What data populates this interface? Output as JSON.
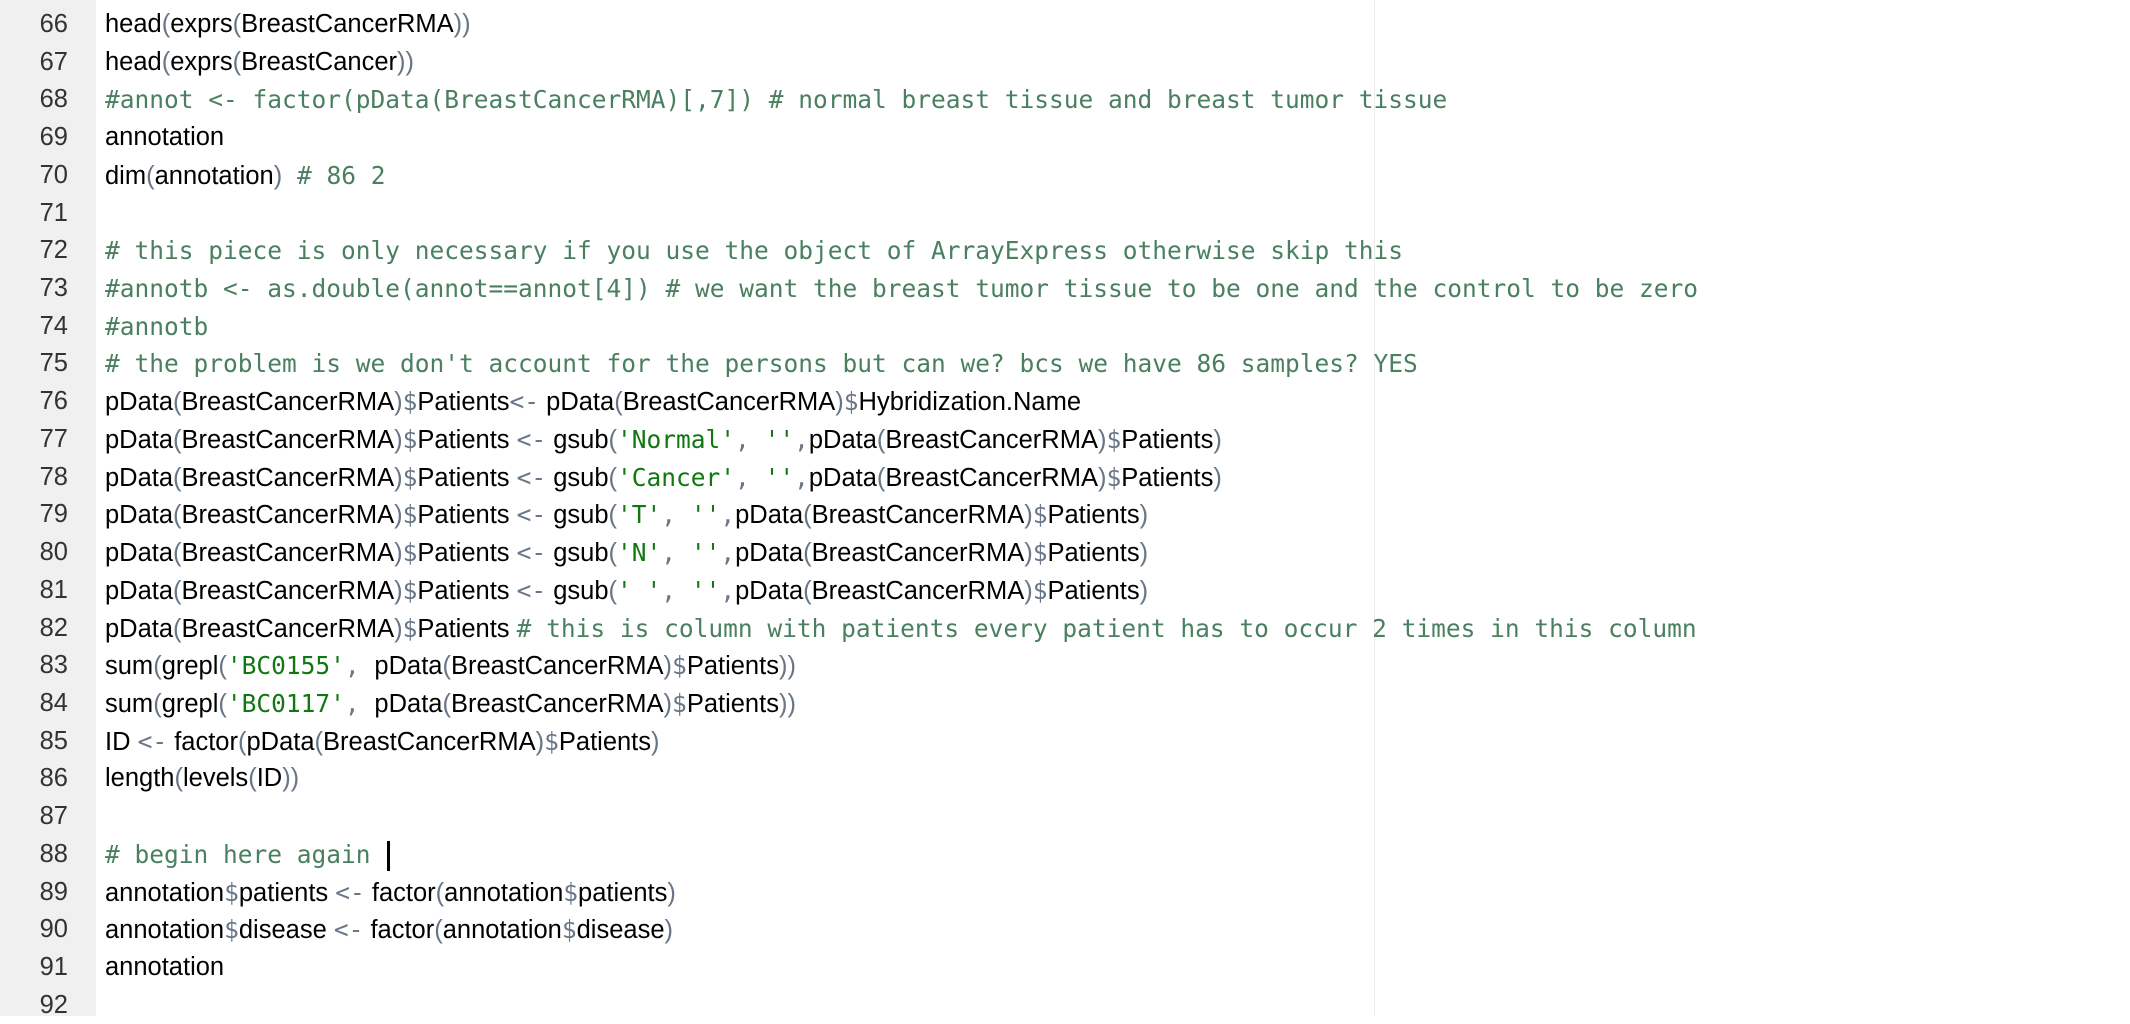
{
  "editor": {
    "colors": {
      "comment": "#4a8060",
      "string": "#117711",
      "operator": "#687687",
      "text": "#000000",
      "gutter_bg": "#f0f0f0",
      "line_number": "#333333"
    },
    "cursor_line": 88,
    "lines": [
      {
        "n": "66",
        "t": [
          [
            "fn",
            "head"
          ],
          [
            "paren",
            "("
          ],
          [
            "fn",
            "exprs"
          ],
          [
            "paren",
            "("
          ],
          [
            "id",
            "BreastCancerRMA"
          ],
          [
            "paren",
            "))"
          ]
        ]
      },
      {
        "n": "67",
        "t": [
          [
            "fn",
            "head"
          ],
          [
            "paren",
            "("
          ],
          [
            "fn",
            "exprs"
          ],
          [
            "paren",
            "("
          ],
          [
            "id",
            "BreastCancer"
          ],
          [
            "paren",
            "))"
          ]
        ]
      },
      {
        "n": "68",
        "t": [
          [
            "cmt",
            "#annot <- factor(pData(BreastCancerRMA)[,7]) # normal breast tissue and breast tumor tissue"
          ]
        ]
      },
      {
        "n": "69",
        "t": [
          [
            "id",
            "annotation"
          ]
        ]
      },
      {
        "n": "70",
        "t": [
          [
            "fn",
            "dim"
          ],
          [
            "paren",
            "("
          ],
          [
            "id",
            "annotation"
          ],
          [
            "paren",
            ")"
          ],
          [
            "cmt",
            " # 86 2"
          ]
        ]
      },
      {
        "n": "71",
        "t": []
      },
      {
        "n": "72",
        "t": [
          [
            "cmt",
            "# this piece is only necessary if you use the object of ArrayExpress otherwise skip this"
          ]
        ]
      },
      {
        "n": "73",
        "t": [
          [
            "cmt",
            "#annotb <- as.double(annot==annot[4]) # we want the breast tumor tissue to be one and the control to be zero"
          ]
        ]
      },
      {
        "n": "74",
        "t": [
          [
            "cmt",
            "#annotb"
          ]
        ]
      },
      {
        "n": "75",
        "t": [
          [
            "cmt",
            "# the problem is we don't account for the persons but can we? bcs we have 86 samples? YES"
          ]
        ]
      },
      {
        "n": "76",
        "t": [
          [
            "fn",
            "pData"
          ],
          [
            "paren",
            "("
          ],
          [
            "id",
            "BreastCancerRMA"
          ],
          [
            "paren",
            ")"
          ],
          [
            "op",
            "$"
          ],
          [
            "id",
            "Patients"
          ],
          [
            "op",
            "<-"
          ],
          [
            "id",
            " pData"
          ],
          [
            "paren",
            "("
          ],
          [
            "id",
            "BreastCancerRMA"
          ],
          [
            "paren",
            ")"
          ],
          [
            "op",
            "$"
          ],
          [
            "id",
            "Hybridization.Name"
          ]
        ]
      },
      {
        "n": "77",
        "t": [
          [
            "fn",
            "pData"
          ],
          [
            "paren",
            "("
          ],
          [
            "id",
            "BreastCancerRMA"
          ],
          [
            "paren",
            ")"
          ],
          [
            "op",
            "$"
          ],
          [
            "id",
            "Patients "
          ],
          [
            "op",
            "<-"
          ],
          [
            "id",
            " gsub"
          ],
          [
            "paren",
            "("
          ],
          [
            "str",
            "'Normal'"
          ],
          [
            "op",
            ", "
          ],
          [
            "str",
            "''"
          ],
          [
            "op",
            ","
          ],
          [
            "id",
            "pData"
          ],
          [
            "paren",
            "("
          ],
          [
            "id",
            "BreastCancerRMA"
          ],
          [
            "paren",
            ")"
          ],
          [
            "op",
            "$"
          ],
          [
            "id",
            "Patients"
          ],
          [
            "paren",
            ")"
          ]
        ]
      },
      {
        "n": "78",
        "t": [
          [
            "fn",
            "pData"
          ],
          [
            "paren",
            "("
          ],
          [
            "id",
            "BreastCancerRMA"
          ],
          [
            "paren",
            ")"
          ],
          [
            "op",
            "$"
          ],
          [
            "id",
            "Patients "
          ],
          [
            "op",
            "<-"
          ],
          [
            "id",
            " gsub"
          ],
          [
            "paren",
            "("
          ],
          [
            "str",
            "'Cancer'"
          ],
          [
            "op",
            ", "
          ],
          [
            "str",
            "''"
          ],
          [
            "op",
            ","
          ],
          [
            "id",
            "pData"
          ],
          [
            "paren",
            "("
          ],
          [
            "id",
            "BreastCancerRMA"
          ],
          [
            "paren",
            ")"
          ],
          [
            "op",
            "$"
          ],
          [
            "id",
            "Patients"
          ],
          [
            "paren",
            ")"
          ]
        ]
      },
      {
        "n": "79",
        "t": [
          [
            "fn",
            "pData"
          ],
          [
            "paren",
            "("
          ],
          [
            "id",
            "BreastCancerRMA"
          ],
          [
            "paren",
            ")"
          ],
          [
            "op",
            "$"
          ],
          [
            "id",
            "Patients "
          ],
          [
            "op",
            "<-"
          ],
          [
            "id",
            " gsub"
          ],
          [
            "paren",
            "("
          ],
          [
            "str",
            "'T'"
          ],
          [
            "op",
            ", "
          ],
          [
            "str",
            "''"
          ],
          [
            "op",
            ","
          ],
          [
            "id",
            "pData"
          ],
          [
            "paren",
            "("
          ],
          [
            "id",
            "BreastCancerRMA"
          ],
          [
            "paren",
            ")"
          ],
          [
            "op",
            "$"
          ],
          [
            "id",
            "Patients"
          ],
          [
            "paren",
            ")"
          ]
        ]
      },
      {
        "n": "80",
        "t": [
          [
            "fn",
            "pData"
          ],
          [
            "paren",
            "("
          ],
          [
            "id",
            "BreastCancerRMA"
          ],
          [
            "paren",
            ")"
          ],
          [
            "op",
            "$"
          ],
          [
            "id",
            "Patients "
          ],
          [
            "op",
            "<-"
          ],
          [
            "id",
            " gsub"
          ],
          [
            "paren",
            "("
          ],
          [
            "str",
            "'N'"
          ],
          [
            "op",
            ", "
          ],
          [
            "str",
            "''"
          ],
          [
            "op",
            ","
          ],
          [
            "id",
            "pData"
          ],
          [
            "paren",
            "("
          ],
          [
            "id",
            "BreastCancerRMA"
          ],
          [
            "paren",
            ")"
          ],
          [
            "op",
            "$"
          ],
          [
            "id",
            "Patients"
          ],
          [
            "paren",
            ")"
          ]
        ]
      },
      {
        "n": "81",
        "t": [
          [
            "fn",
            "pData"
          ],
          [
            "paren",
            "("
          ],
          [
            "id",
            "BreastCancerRMA"
          ],
          [
            "paren",
            ")"
          ],
          [
            "op",
            "$"
          ],
          [
            "id",
            "Patients "
          ],
          [
            "op",
            "<-"
          ],
          [
            "id",
            " gsub"
          ],
          [
            "paren",
            "("
          ],
          [
            "str",
            "' '"
          ],
          [
            "op",
            ", "
          ],
          [
            "str",
            "''"
          ],
          [
            "op",
            ","
          ],
          [
            "id",
            "pData"
          ],
          [
            "paren",
            "("
          ],
          [
            "id",
            "BreastCancerRMA"
          ],
          [
            "paren",
            ")"
          ],
          [
            "op",
            "$"
          ],
          [
            "id",
            "Patients"
          ],
          [
            "paren",
            ")"
          ]
        ]
      },
      {
        "n": "82",
        "t": [
          [
            "fn",
            "pData"
          ],
          [
            "paren",
            "("
          ],
          [
            "id",
            "BreastCancerRMA"
          ],
          [
            "paren",
            ")"
          ],
          [
            "op",
            "$"
          ],
          [
            "id",
            "Patients "
          ],
          [
            "cmt",
            "# this is column with patients every patient has to occur 2 times in this column"
          ]
        ]
      },
      {
        "n": "83",
        "t": [
          [
            "fn",
            "sum"
          ],
          [
            "paren",
            "("
          ],
          [
            "fn",
            "grepl"
          ],
          [
            "paren",
            "("
          ],
          [
            "str",
            "'BC0155'"
          ],
          [
            "op",
            ", "
          ],
          [
            "id",
            "pData"
          ],
          [
            "paren",
            "("
          ],
          [
            "id",
            "BreastCancerRMA"
          ],
          [
            "paren",
            ")"
          ],
          [
            "op",
            "$"
          ],
          [
            "id",
            "Patients"
          ],
          [
            "paren",
            "))"
          ]
        ]
      },
      {
        "n": "84",
        "t": [
          [
            "fn",
            "sum"
          ],
          [
            "paren",
            "("
          ],
          [
            "fn",
            "grepl"
          ],
          [
            "paren",
            "("
          ],
          [
            "str",
            "'BC0117'"
          ],
          [
            "op",
            ", "
          ],
          [
            "id",
            "pData"
          ],
          [
            "paren",
            "("
          ],
          [
            "id",
            "BreastCancerRMA"
          ],
          [
            "paren",
            ")"
          ],
          [
            "op",
            "$"
          ],
          [
            "id",
            "Patients"
          ],
          [
            "paren",
            "))"
          ]
        ]
      },
      {
        "n": "85",
        "t": [
          [
            "id",
            "ID "
          ],
          [
            "op",
            "<-"
          ],
          [
            "id",
            " factor"
          ],
          [
            "paren",
            "("
          ],
          [
            "id",
            "pData"
          ],
          [
            "paren",
            "("
          ],
          [
            "id",
            "BreastCancerRMA"
          ],
          [
            "paren",
            ")"
          ],
          [
            "op",
            "$"
          ],
          [
            "id",
            "Patients"
          ],
          [
            "paren",
            ")"
          ]
        ]
      },
      {
        "n": "86",
        "t": [
          [
            "fn",
            "length"
          ],
          [
            "paren",
            "("
          ],
          [
            "fn",
            "levels"
          ],
          [
            "paren",
            "("
          ],
          [
            "id",
            "ID"
          ],
          [
            "paren",
            "))"
          ]
        ]
      },
      {
        "n": "87",
        "t": []
      },
      {
        "n": "88",
        "t": [
          [
            "cmt",
            "# begin here again "
          ]
        ]
      },
      {
        "n": "89",
        "t": [
          [
            "id",
            "annotation"
          ],
          [
            "op",
            "$"
          ],
          [
            "id",
            "patients "
          ],
          [
            "op",
            "<-"
          ],
          [
            "id",
            " factor"
          ],
          [
            "paren",
            "("
          ],
          [
            "id",
            "annotation"
          ],
          [
            "op",
            "$"
          ],
          [
            "id",
            "patients"
          ],
          [
            "paren",
            ")"
          ]
        ]
      },
      {
        "n": "90",
        "t": [
          [
            "id",
            "annotation"
          ],
          [
            "op",
            "$"
          ],
          [
            "id",
            "disease "
          ],
          [
            "op",
            "<-"
          ],
          [
            "id",
            " factor"
          ],
          [
            "paren",
            "("
          ],
          [
            "id",
            "annotation"
          ],
          [
            "op",
            "$"
          ],
          [
            "id",
            "disease"
          ],
          [
            "paren",
            ")"
          ]
        ]
      },
      {
        "n": "91",
        "t": [
          [
            "id",
            "annotation"
          ]
        ]
      },
      {
        "n": "92",
        "t": []
      }
    ]
  }
}
